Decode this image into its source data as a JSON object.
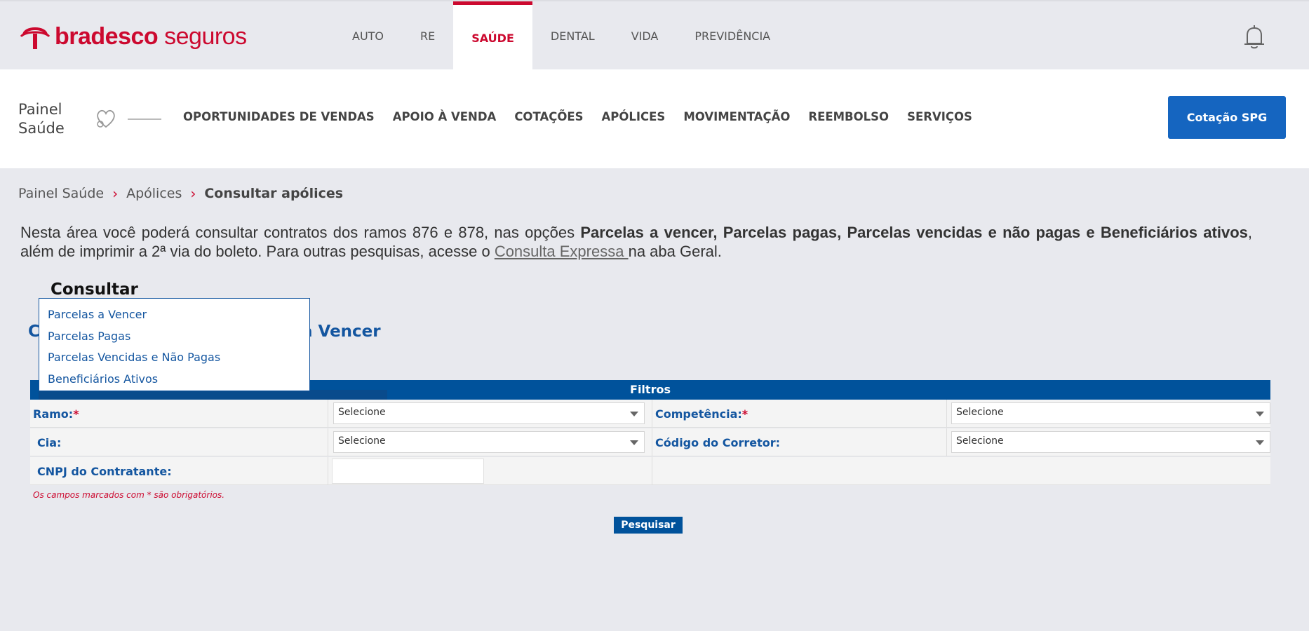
{
  "brand": {
    "name_bold": "bradesco",
    "name_light": " seguros",
    "color": "#cc092f"
  },
  "top_tabs": [
    {
      "label": "AUTO",
      "active": false
    },
    {
      "label": "RE",
      "active": false
    },
    {
      "label": "SAÚDE",
      "active": true
    },
    {
      "label": "DENTAL",
      "active": false
    },
    {
      "label": "VIDA",
      "active": false
    },
    {
      "label": "PREVIDÊNCIA",
      "active": false
    }
  ],
  "subnav": {
    "panel_title_line1": "Painel",
    "panel_title_line2": "Saúde",
    "menu": [
      "OPORTUNIDADES DE VENDAS",
      "APOIO À VENDA",
      "COTAÇÕES",
      "APÓLICES",
      "MOVIMENTAÇÃO",
      "REEMBOLSO",
      "SERVIÇOS"
    ],
    "cta_label": "Cotação SPG"
  },
  "breadcrumb": [
    "Painel Saúde",
    "Apólices",
    "Consultar apólices"
  ],
  "intro": {
    "part1": "Nesta área você poderá consultar contratos dos ramos 876 e 878, nas opções ",
    "bold": "Parcelas a vencer, Parcelas pagas, Parcelas vencidas e não pagas e Beneficiários ativos",
    "part2": ", além de imprimir a 2ª via do boleto. Para outras pesquisas, acesse o ",
    "link": "Consulta Expressa ",
    "part3": "na aba Geral."
  },
  "consultar": {
    "label": "Consultar",
    "options": [
      "Parcelas a Vencer",
      "Parcelas Pagas",
      "Parcelas Vencidas e Não Pagas",
      "Beneficiários Ativos"
    ]
  },
  "section_title_prefix": "C",
  "section_title_suffix": "a Vencer",
  "filters": {
    "header": "Filtros",
    "ramo_label": "Ramo:",
    "competencia_label": "Competência:",
    "cia_label": "Cia:",
    "codigo_label": "Código do Corretor:",
    "cnpj_label": "CNPJ do Contratante:",
    "select_placeholder": "Selecione",
    "required_mark": "*",
    "required_note": "Os campos marcados com * são obrigatórios.",
    "search_label": "Pesquisar"
  }
}
